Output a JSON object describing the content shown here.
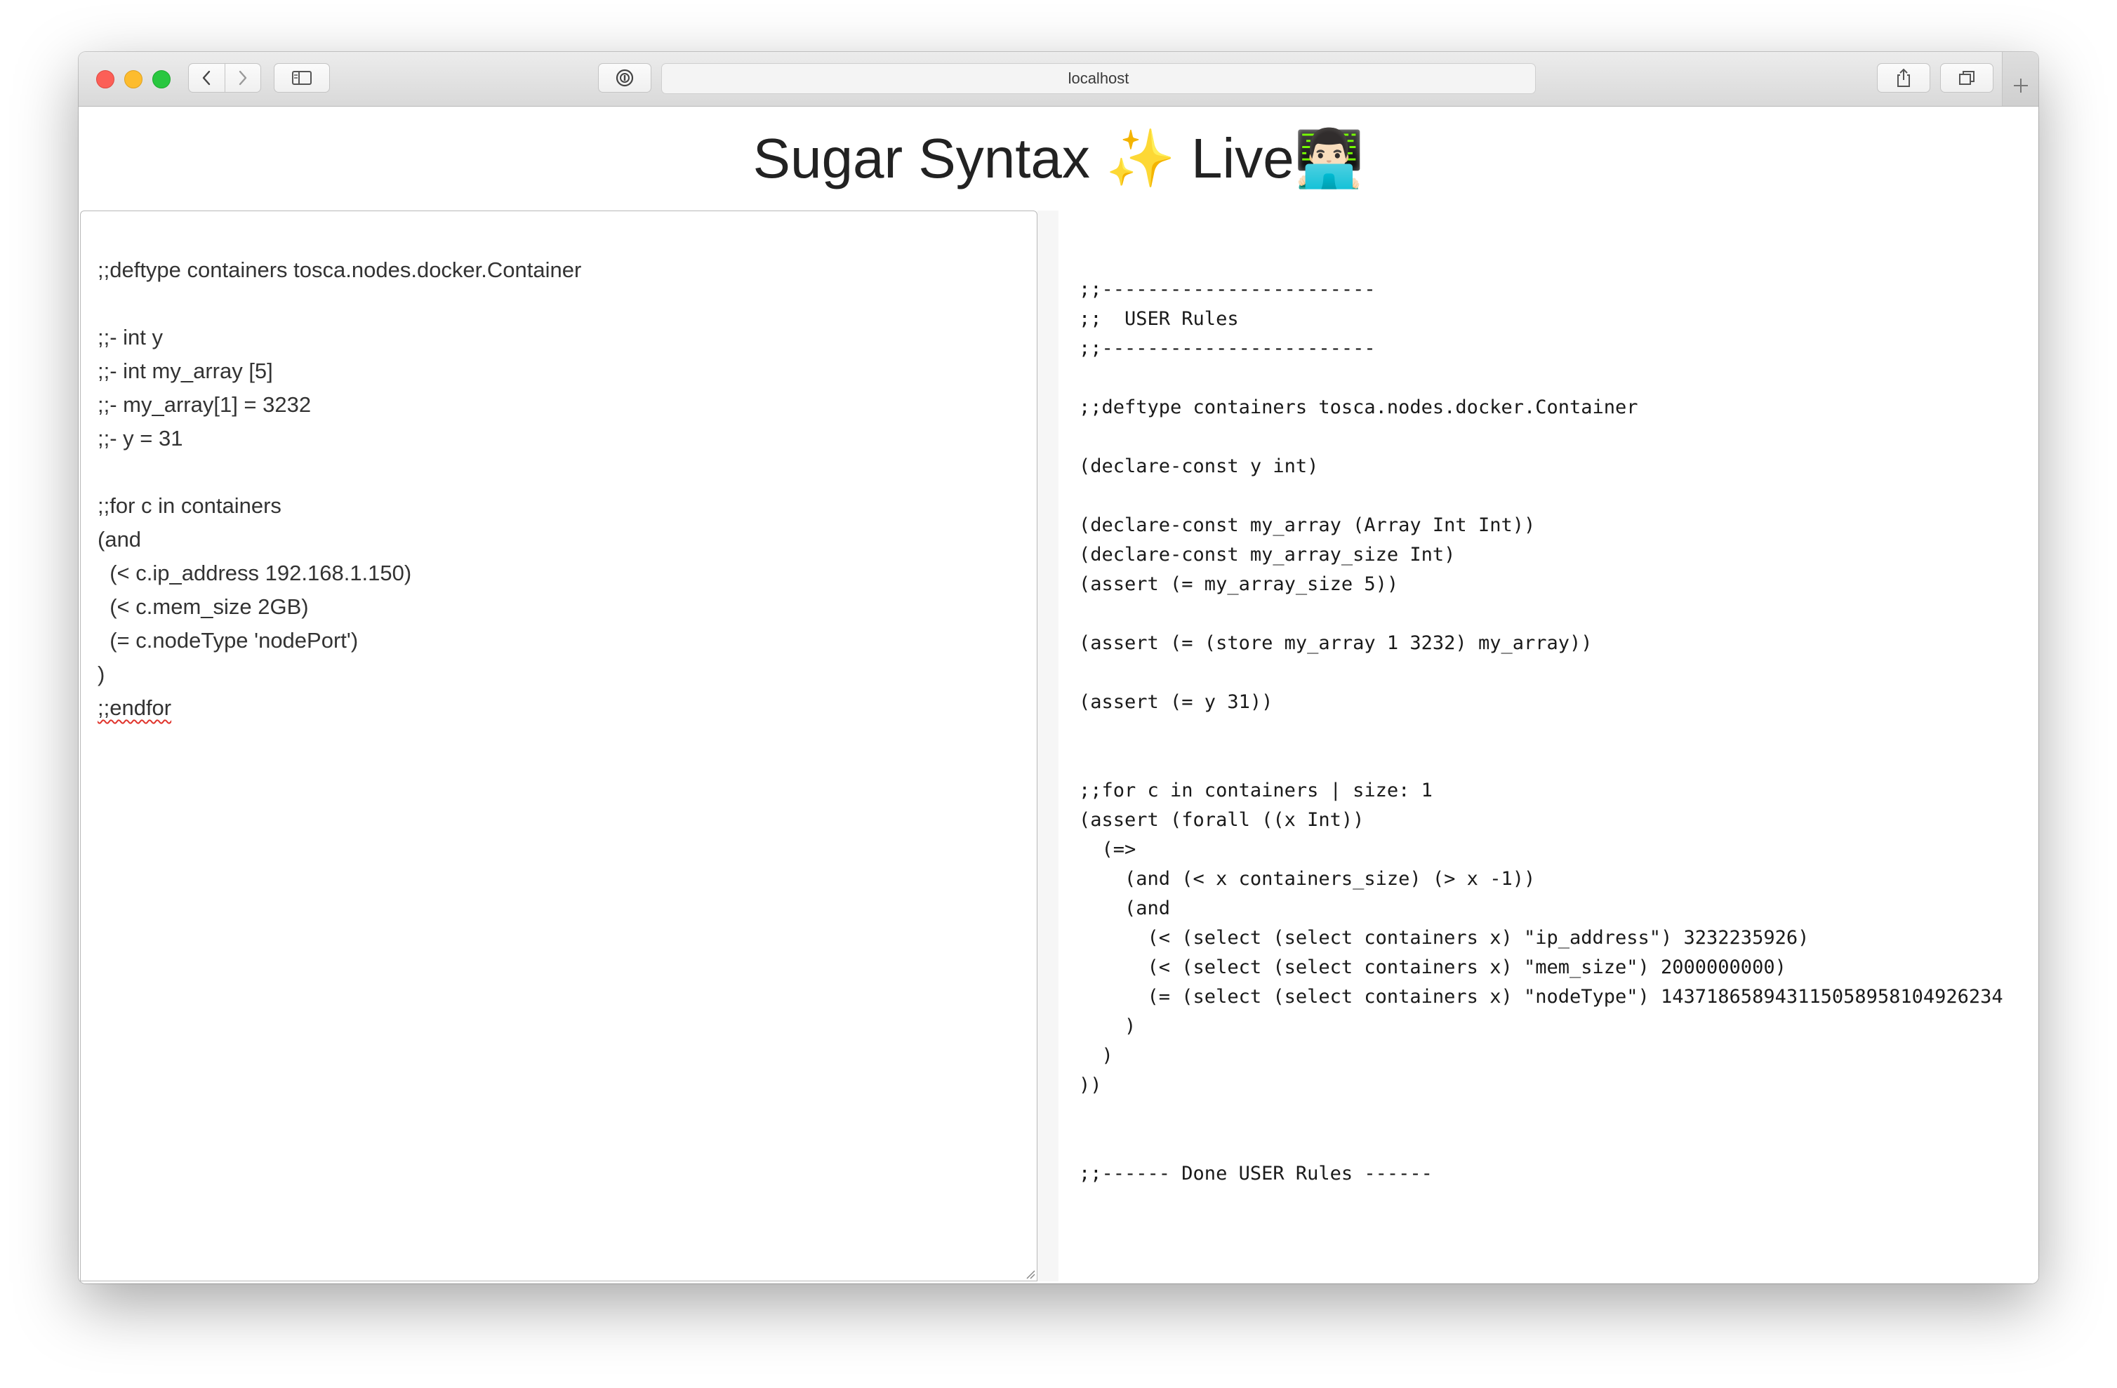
{
  "browser": {
    "url": "localhost"
  },
  "page": {
    "title": "Sugar Syntax ✨ Live👨🏻‍💻"
  },
  "editor": {
    "lines": [
      ";;deftype containers tosca.nodes.docker.Container",
      "",
      ";;- int y",
      ";;- int my_array [5]",
      ";;- my_array[1] = 3232",
      ";;- y = 31",
      "",
      ";;for c in containers",
      "(and",
      "  (< c.ip_address 192.168.1.150)",
      "  (< c.mem_size 2GB)",
      "  (= c.nodeType 'nodePort')",
      ")",
      ";;endfor"
    ]
  },
  "output": {
    "lines": [
      ";;------------------------",
      ";;  USER Rules",
      ";;------------------------",
      "",
      ";;deftype containers tosca.nodes.docker.Container",
      "",
      "(declare-const y int)",
      "",
      "(declare-const my_array (Array Int Int))",
      "(declare-const my_array_size Int)",
      "(assert (= my_array_size 5))",
      "",
      "(assert (= (store my_array 1 3232) my_array))",
      "",
      "(assert (= y 31))",
      "",
      "",
      ";;for c in containers | size: 1",
      "(assert (forall ((x Int))",
      "  (=>",
      "    (and (< x containers_size) (> x -1))",
      "    (and",
      "      (< (select (select containers x) \"ip_address\") 3232235926)",
      "      (< (select (select containers x) \"mem_size\") 2000000000)",
      "      (= (select (select containers x) \"nodeType\") 143718658943115058958104926234",
      "    )",
      "  )",
      "))",
      "",
      "",
      ";;------ Done USER Rules ------"
    ]
  }
}
